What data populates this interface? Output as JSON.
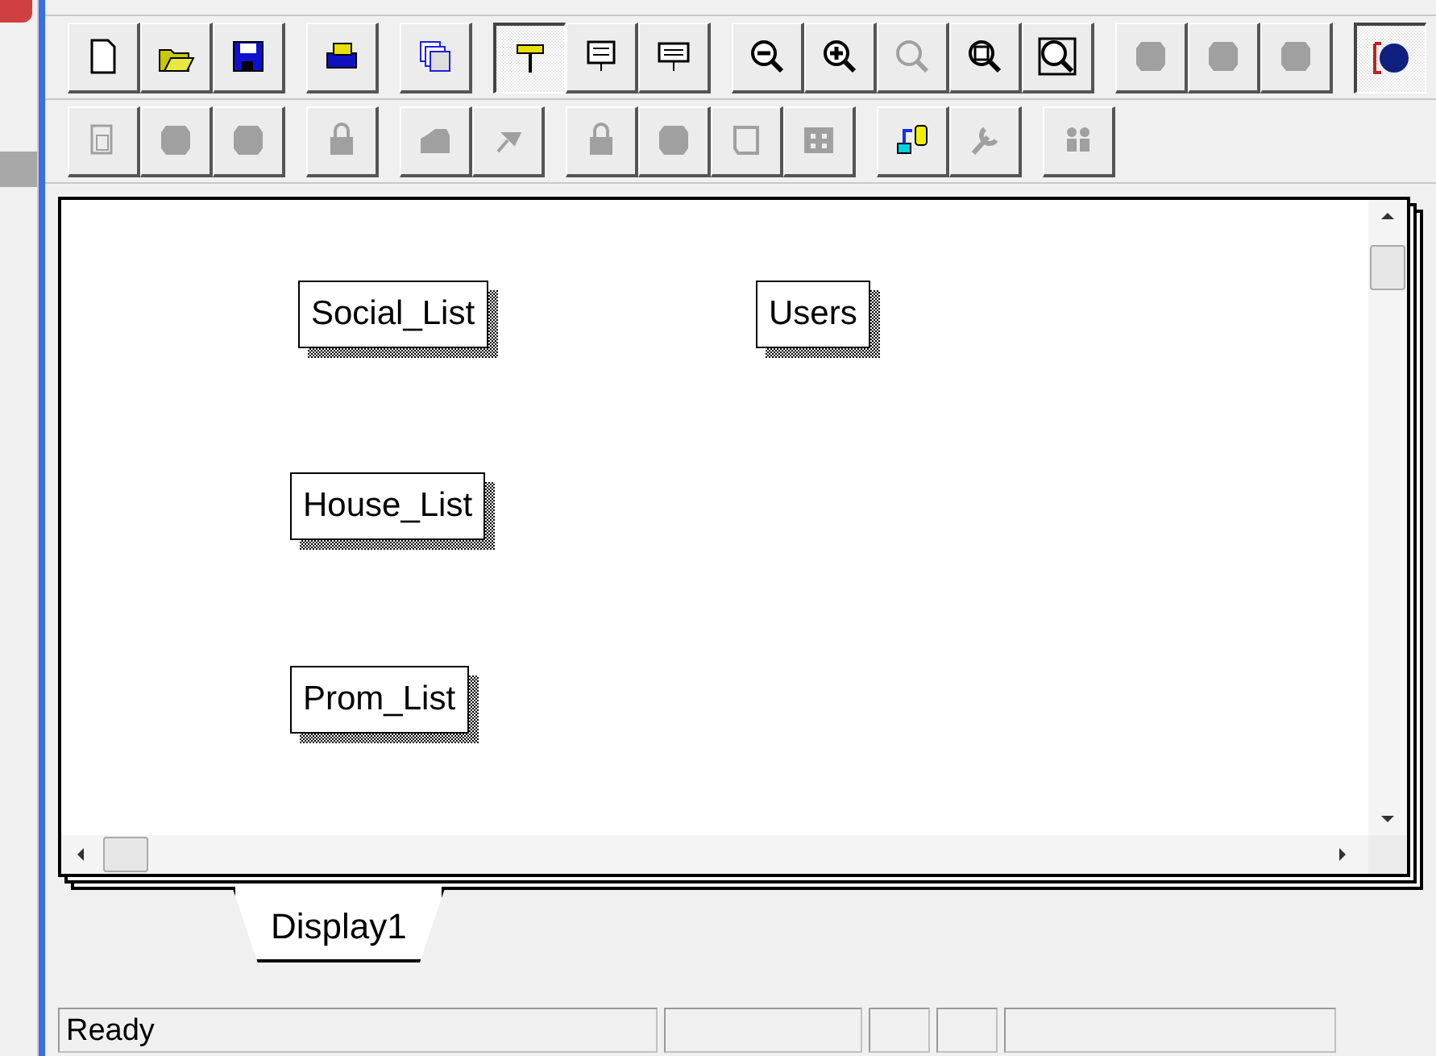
{
  "toolbars": [
    {
      "groups": [
        [
          {
            "disabled": false,
            "pressed": false
          },
          {
            "disabled": false,
            "pressed": false
          },
          {
            "disabled": false,
            "pressed": false
          }
        ],
        [
          {
            "disabled": false,
            "pressed": false
          }
        ],
        [
          {
            "disabled": false,
            "pressed": false
          }
        ],
        [
          {
            "disabled": false,
            "pressed": true
          },
          {
            "disabled": false,
            "pressed": false
          },
          {
            "disabled": false,
            "pressed": false
          }
        ],
        [
          {
            "disabled": false,
            "pressed": false
          },
          {
            "disabled": false,
            "pressed": false
          },
          {
            "disabled": true,
            "pressed": false
          },
          {
            "disabled": false,
            "pressed": false
          },
          {
            "disabled": false,
            "pressed": false
          }
        ],
        [
          {
            "disabled": true,
            "pressed": false
          },
          {
            "disabled": true,
            "pressed": false
          },
          {
            "disabled": true,
            "pressed": false
          }
        ],
        [
          {
            "disabled": false,
            "pressed": true
          }
        ]
      ]
    },
    {
      "groups": [
        [
          {
            "disabled": true,
            "pressed": false
          },
          {
            "disabled": true,
            "pressed": false
          },
          {
            "disabled": true,
            "pressed": false
          }
        ],
        [
          {
            "disabled": true,
            "pressed": false
          }
        ],
        [
          {
            "disabled": true,
            "pressed": false
          },
          {
            "disabled": true,
            "pressed": false
          }
        ],
        [
          {
            "disabled": true,
            "pressed": false
          },
          {
            "disabled": true,
            "pressed": false
          },
          {
            "disabled": true,
            "pressed": false
          },
          {
            "disabled": true,
            "pressed": false
          }
        ],
        [
          {
            "disabled": false,
            "pressed": false
          },
          {
            "disabled": true,
            "pressed": false
          }
        ],
        [
          {
            "disabled": true,
            "pressed": false
          }
        ]
      ]
    }
  ],
  "canvas": {
    "tables": [
      {
        "name": "Social_List"
      },
      {
        "name": "Users"
      },
      {
        "name": "House_List"
      },
      {
        "name": "Prom_List"
      }
    ]
  },
  "tabs": [
    {
      "label": "Display1",
      "selected": true
    }
  ],
  "status_bar": {
    "text": "Ready"
  }
}
